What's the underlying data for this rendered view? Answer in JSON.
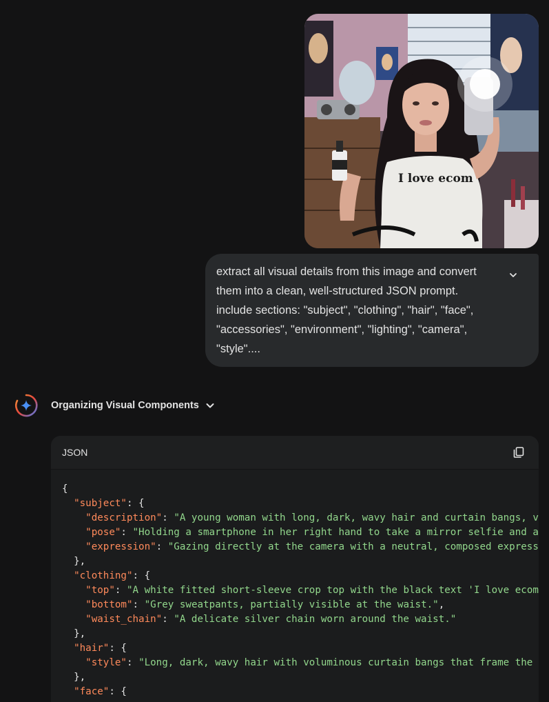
{
  "prompt": {
    "text": "extract all visual details from this image and convert\nthem into a clean, well-structured JSON prompt.\ninclude sections: \"subject\", \"clothing\", \"hair\", \"face\",\n\"accessories\", \"environment\", \"lighting\", \"camera\",\n\"style\"....",
    "shirt_text": "I love ecom"
  },
  "response": {
    "thinking_title": "Organizing Visual Components"
  },
  "code": {
    "language": "JSON",
    "lines": [
      {
        "indent": 0,
        "text": "{"
      },
      {
        "indent": 2,
        "key": "\"subject\"",
        "rest": ": {"
      },
      {
        "indent": 4,
        "key": "\"description\"",
        "rest": ": ",
        "value": "\"A young woman with long, dark, wavy hair and curtain bangs, vie"
      },
      {
        "indent": 4,
        "key": "\"pose\"",
        "rest": ": ",
        "value": "\"Holding a smartphone in her right hand to take a mirror selfie and a s"
      },
      {
        "indent": 4,
        "key": "\"expression\"",
        "rest": ": ",
        "value": "\"Gazing directly at the camera with a neutral, composed expressio"
      },
      {
        "indent": 2,
        "text": "},"
      },
      {
        "indent": 2,
        "key": "\"clothing\"",
        "rest": ": {"
      },
      {
        "indent": 4,
        "key": "\"top\"",
        "rest": ": ",
        "value": "\"A white fitted short-sleeve crop top with the black text 'I love ecom'"
      },
      {
        "indent": 4,
        "key": "\"bottom\"",
        "rest": ": ",
        "value": "\"Grey sweatpants, partially visible at the waist.\"",
        "tail": ","
      },
      {
        "indent": 4,
        "key": "\"waist_chain\"",
        "rest": ": ",
        "value": "\"A delicate silver chain worn around the waist.\""
      },
      {
        "indent": 2,
        "text": "},"
      },
      {
        "indent": 2,
        "key": "\"hair\"",
        "rest": ": {"
      },
      {
        "indent": 4,
        "key": "\"style\"",
        "rest": ": ",
        "value": "\"Long, dark, wavy hair with voluminous curtain bangs that frame the fa"
      },
      {
        "indent": 2,
        "text": "},"
      },
      {
        "indent": 2,
        "key": "\"face\"",
        "rest": ": {"
      }
    ]
  },
  "colors": {
    "background": "#131314",
    "bubble": "#282a2c",
    "code_bg": "#1b1c1d",
    "json_key": "#ff8a5b",
    "json_string": "#92d78c"
  },
  "icons": {
    "expand": "chevron-down-icon",
    "thinking_toggle": "chevron-down-icon",
    "assistant": "gemini-spark-icon",
    "copy": "copy-icon"
  }
}
